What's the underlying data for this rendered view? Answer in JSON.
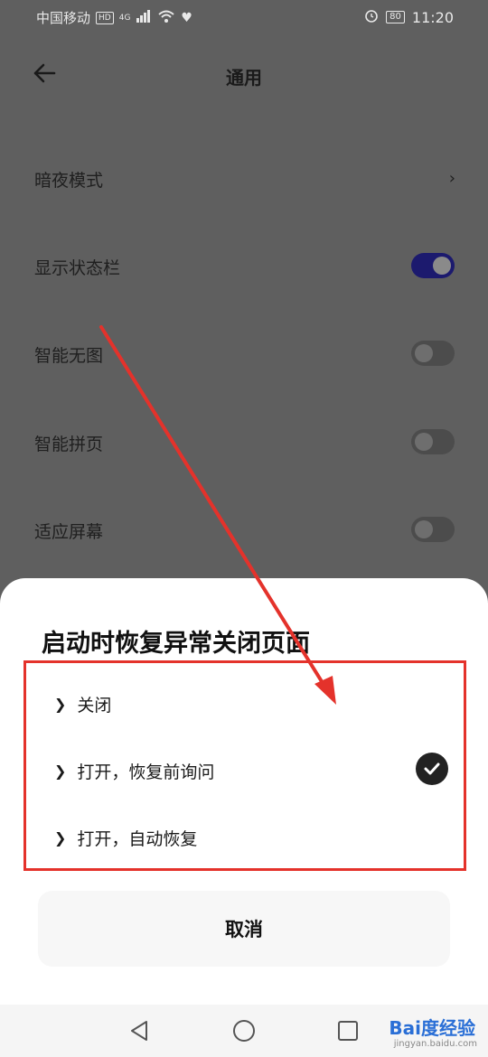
{
  "status_bar": {
    "carrier": "中国移动",
    "hd": "HD",
    "network": "4G",
    "battery": "80",
    "time": "11:20"
  },
  "header": {
    "title": "通用"
  },
  "settings": [
    {
      "label": "暗夜模式",
      "control": "chevron"
    },
    {
      "label": "显示状态栏",
      "control": "toggle",
      "on": true
    },
    {
      "label": "智能无图",
      "control": "toggle",
      "on": false
    },
    {
      "label": "智能拼页",
      "control": "toggle",
      "on": false
    },
    {
      "label": "适应屏幕",
      "control": "toggle",
      "on": false
    }
  ],
  "sheet": {
    "title": "启动时恢复异常关闭页面",
    "options": [
      {
        "label": "关闭",
        "selected": false
      },
      {
        "label": "打开，恢复前询问",
        "selected": true
      },
      {
        "label": "打开，自动恢复",
        "selected": false
      }
    ],
    "cancel": "取消"
  },
  "watermark": {
    "brand": "Bai度经验",
    "url": "jingyan.baidu.com"
  },
  "colors": {
    "accent_toggle": "#1c1a6e",
    "highlight": "#e4322b",
    "overlay": "#5f5f5f"
  }
}
